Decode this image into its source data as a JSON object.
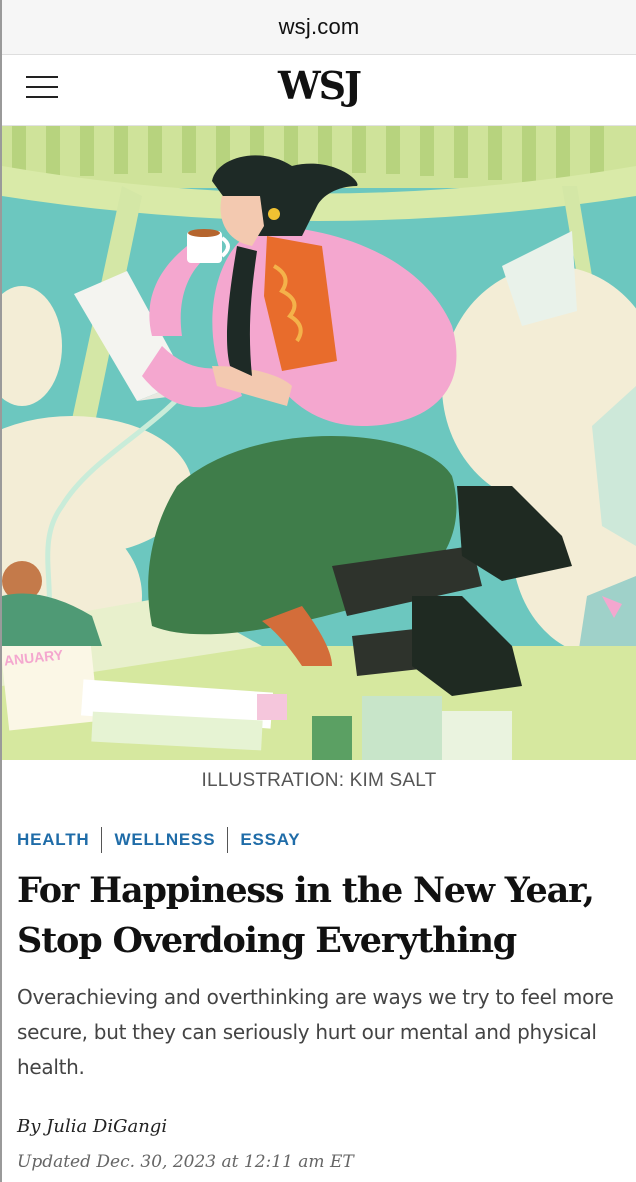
{
  "browser": {
    "url": "wsj.com"
  },
  "header": {
    "logo": "WSJ",
    "menu_icon": "hamburger-menu-icon"
  },
  "hero": {
    "caption": "ILLUSTRATION: KIM SALT",
    "calendar_text": "ANUARY",
    "colors": {
      "sky": "#6cc7bf",
      "cloud": "#f3edd6",
      "skirt": "#3f7d4a",
      "sweater": "#f4a7cf",
      "vest": "#e86c2c",
      "hair": "#1e2a26"
    }
  },
  "article": {
    "tags": [
      "HEALTH",
      "WELLNESS",
      "ESSAY"
    ],
    "headline": "For Happiness in the New Year, Stop Overdoing Everything",
    "dek": "Overachieving and overthinking are ways we try to feel more secure, but they can seriously hurt our mental and physical health.",
    "byline_prefix": "By",
    "author": "Julia DiGangi",
    "timestamp": "Updated Dec. 30, 2023 at 12:11 am ET"
  },
  "colors": {
    "tag_blue": "#1f6ca8",
    "text": "#111111",
    "dek_gray": "#444444"
  }
}
